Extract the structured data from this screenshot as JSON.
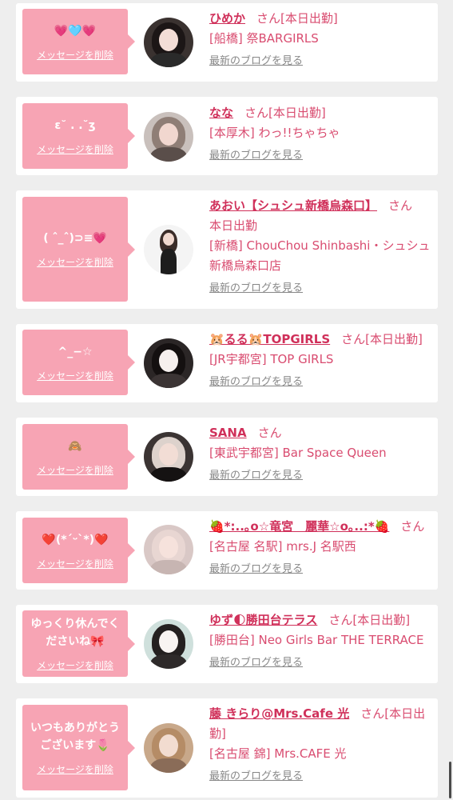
{
  "delete_label": "メッセージを削除",
  "blog_label": "最新のブログを見る",
  "honorific": "さん",
  "colors": {
    "background": "#eeeeee",
    "bubble": "#f7a4b4",
    "name": "#d0305a",
    "text": "#d94c70",
    "link_gray": "#888888"
  },
  "cards": [
    {
      "message": "💗🩵💗",
      "name": "ひめか",
      "status": "[本日出勤]",
      "shop": "[船橋] 祭BARGIRLS",
      "avatar": {
        "bg": "#3a3230",
        "hair": "#1c1616",
        "skin": "#f3ddd6",
        "cloth": "#2a2a2a"
      }
    },
    {
      "message": "ε˘ . .˘ʒ",
      "name": "なな",
      "status": "[本日出勤]",
      "shop": "[本厚木] わっ!!ちゃちゃ",
      "avatar": {
        "bg": "#c9c0bc",
        "hair": "#8f7e76",
        "skin": "#f1d7cf",
        "cloth": "#5a4e4a"
      }
    },
    {
      "message": "( ˆ_ˆ)⊃≡💗",
      "name": "あおい【シュシュ新橋烏森口】",
      "status": "本日出勤",
      "shop": "[新橋] ChouChou Shinbashi・シュシュ新橋烏森口店",
      "avatar": {
        "bg": "#f4f4f4",
        "hair": "#3a2c28",
        "skin": "#f0d8ce",
        "cloth": "#1d1d1d"
      }
    },
    {
      "message": "^_−☆",
      "name": "🐹るる🐹TOPGIRLS",
      "status": "[本日出勤]",
      "shop": "[JR宇都宮] TOP GIRLS",
      "avatar": {
        "bg": "#2b2626",
        "hair": "#141010",
        "skin": "#f6f0ee",
        "cloth": "#3b3434"
      }
    },
    {
      "message": "🙈",
      "name": "SANA",
      "status": "",
      "shop": "[東武宇都宮] Bar Space Queen",
      "avatar": {
        "bg": "#3b3433",
        "hair": "#ddd2cc",
        "skin": "#f2ddd5",
        "cloth": "#151212"
      }
    },
    {
      "message": "❤️(*ˊᵕˋ*)❤️",
      "name": "🍓*:..｡o☆竜宮　麗華☆o｡..:*🍓",
      "status": "",
      "shop": "[名古屋 名駅] mrs.J 名駅西",
      "avatar": {
        "bg": "#d9c8c6",
        "hair": "#e8d6d2",
        "skin": "#f6e2dc",
        "cloth": "#c7b5b2"
      }
    },
    {
      "message": "ゆっくり休んでくださいね🎀",
      "name": "ゆず🌓勝田台テラス",
      "status": "[本日出勤]",
      "shop": "[勝田台] Neo Girls Bar THE TERRACE",
      "avatar": {
        "bg": "#cfe0dc",
        "hair": "#242020",
        "skin": "#f8f4f2",
        "cloth": "#2e2a2a"
      }
    },
    {
      "message": "いつもありがとうございます🌷",
      "name": "藤 きらり@Mrs.Cafe 光",
      "status": "[本日出勤]",
      "shop": "[名古屋 錦] Mrs.CAFE 光",
      "avatar": {
        "bg": "#c8a88a",
        "hair": "#b58c66",
        "skin": "#f2dcd0",
        "cloth": "#8a6c58"
      }
    }
  ]
}
